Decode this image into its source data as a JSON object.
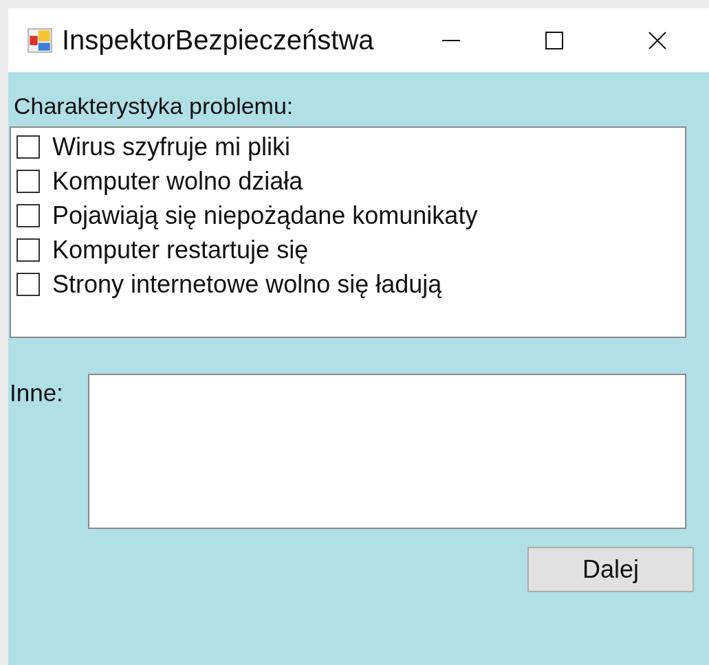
{
  "window": {
    "title": "InspektorBezpieczeństwa"
  },
  "problem_label": "Charakterystyka problemu:",
  "checklist": [
    {
      "label": "Wirus szyfruje mi pliki",
      "checked": false
    },
    {
      "label": "Komputer wolno działa",
      "checked": false
    },
    {
      "label": "Pojawiają się niepożądane komunikaty",
      "checked": false
    },
    {
      "label": "Komputer restartuje się",
      "checked": false
    },
    {
      "label": "Strony internetowe wolno się ładują",
      "checked": false
    }
  ],
  "other": {
    "label": "Inne:"
  },
  "buttons": [
    "Dalej"
  ]
}
